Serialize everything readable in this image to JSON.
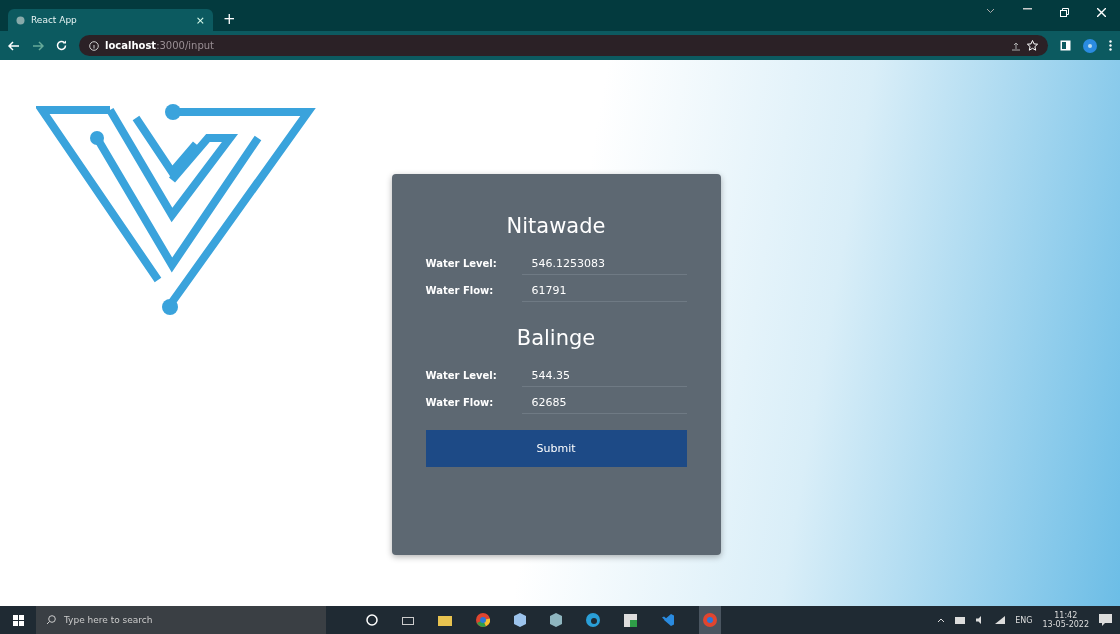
{
  "browser": {
    "tab": {
      "title": "React App",
      "close": "×"
    },
    "new_tab": "+",
    "address": {
      "host": "localhost",
      "path": ":3000/input"
    }
  },
  "form": {
    "sections": [
      {
        "title": "Nitawade",
        "fields": [
          {
            "label": "Water Level:",
            "value": "546.1253083"
          },
          {
            "label": "Water Flow:",
            "value": "61791"
          }
        ]
      },
      {
        "title": "Balinge",
        "fields": [
          {
            "label": "Water Level:",
            "value": "544.35"
          },
          {
            "label": "Water Flow:",
            "value": "62685"
          }
        ]
      }
    ],
    "submit": "Submit"
  },
  "taskbar": {
    "search_placeholder": "Type here to search",
    "language": "ENG",
    "time": "11:42",
    "date": "13-05-2022"
  }
}
